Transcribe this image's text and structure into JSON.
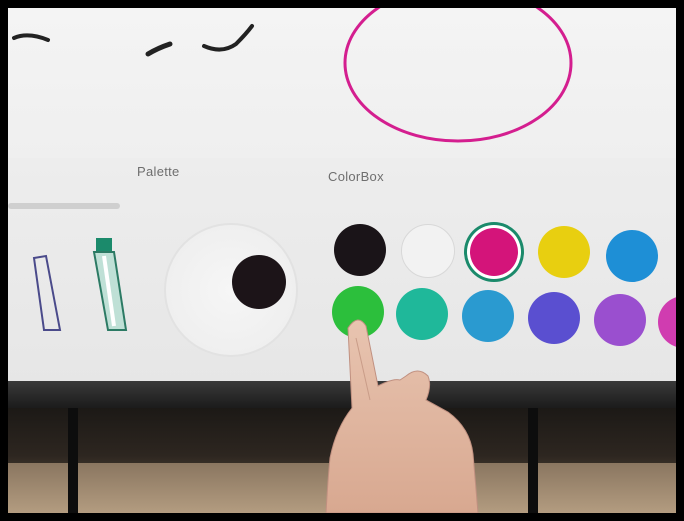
{
  "panel": {
    "palette_label": "Palette",
    "colorbox_label": "ColorBox"
  },
  "current_color": "#1c1418",
  "colors": {
    "row1": [
      "#1a1418",
      "#f2f2f2",
      "#d4147a",
      "#e8cf10",
      "#1e8fd6"
    ],
    "row2": [
      "#2cbf3c",
      "#1fb89a",
      "#2a9ad0",
      "#5a4fd0",
      "#9a4fcf",
      "#d03cb0"
    ],
    "selected": "#d4147a",
    "selected_ring": "#1b8a6b",
    "drawn_circle": "#d41e8f"
  }
}
